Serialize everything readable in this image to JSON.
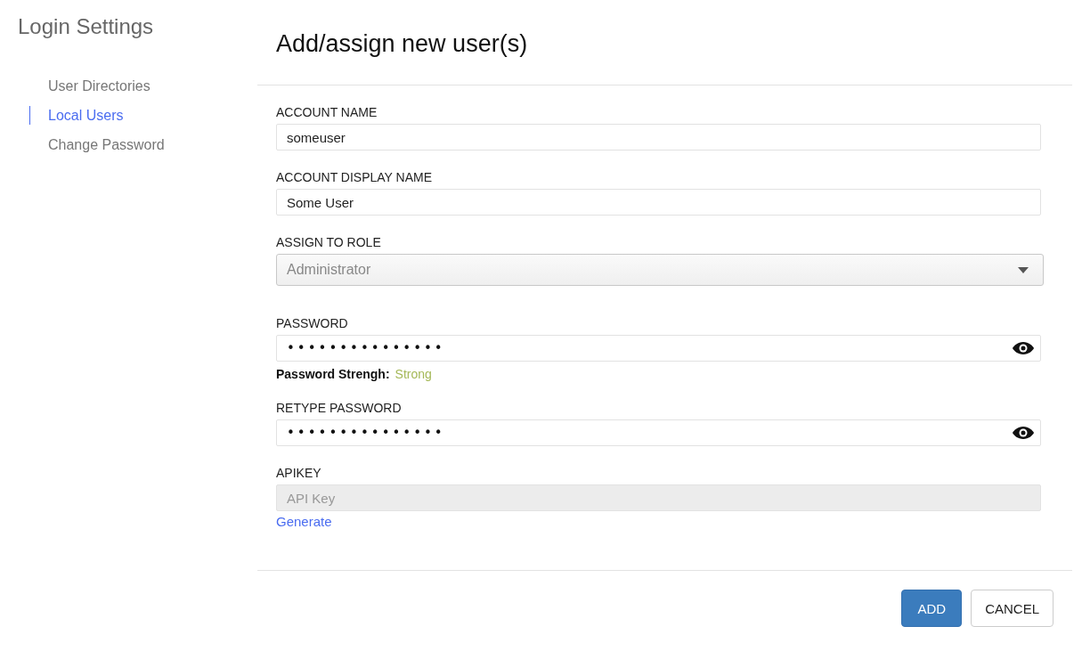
{
  "sidebar": {
    "title": "Login Settings",
    "items": [
      {
        "label": "User Directories",
        "selected": false
      },
      {
        "label": "Local Users",
        "selected": true
      },
      {
        "label": "Change Password",
        "selected": false
      }
    ]
  },
  "form": {
    "title": "Add/assign new user(s)",
    "fields": [
      {
        "kind": "text",
        "label": "ACCOUNT NAME",
        "value": "someuser"
      },
      {
        "kind": "text",
        "label": "ACCOUNT DISPLAY NAME",
        "value": "Some User"
      },
      {
        "kind": "select",
        "label": "ASSIGN TO ROLE",
        "value": "Administrator"
      },
      {
        "kind": "password",
        "label": "PASSWORD",
        "value": "•••••••••••••••",
        "strength_label": "Password Strengh:",
        "strength": "Strong"
      },
      {
        "kind": "password",
        "label": "RETYPE PASSWORD",
        "value": "•••••••••••••••"
      },
      {
        "kind": "disabled",
        "label": "APIKEY",
        "placeholder": "API Key",
        "link": "Generate"
      }
    ]
  },
  "buttons": [
    {
      "label": "ADD",
      "kind": "primary"
    },
    {
      "label": "CANCEL",
      "kind": "secondary"
    }
  ]
}
